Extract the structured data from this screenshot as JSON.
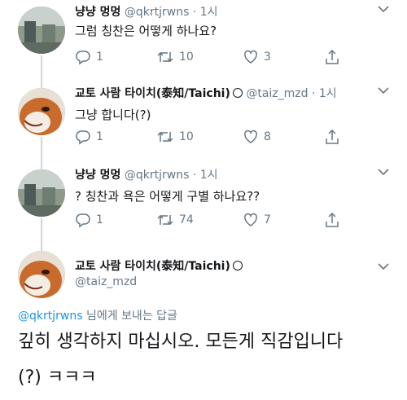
{
  "tweets": [
    {
      "name": "냥냥 멍멍",
      "handle": "@qkrtjrwns",
      "dot": "·",
      "time": "1시",
      "text": "그럼 칭찬은 어떻게 하나요?",
      "replies": "1",
      "retweets": "10",
      "likes": "3"
    },
    {
      "name": "교토 사람 타이치(泰知/Taichi)",
      "handle": "@taiz_mzd",
      "dot": "·",
      "time": "1시",
      "text": "그냥 합니다(?)",
      "replies": "1",
      "retweets": "10",
      "likes": "8"
    },
    {
      "name": "냥냥 멍멍",
      "handle": "@qkrtjrwns",
      "dot": "·",
      "time": "1시",
      "text": "? 칭찬과 욕은 어떻게 구별 하나요??",
      "replies": "1",
      "retweets": "74",
      "likes": "7"
    }
  ],
  "main_tweet": {
    "name": "교토 사람 타이치(泰知/Taichi)",
    "handle": "@taiz_mzd",
    "replying_mention": "@qkrtjrwns",
    "replying_suffix": " 님에게 보내는 답글",
    "text_line1": "깊히 생각하지 마십시오. 모든게 직감입니다",
    "text_line2": "(?) ㅋㅋㅋ"
  },
  "colors": {
    "text": "#14171a",
    "muted": "#657786",
    "link": "#1b95e0",
    "thread_line": "#ccd6dd"
  },
  "icons": [
    "reply-icon",
    "retweet-icon",
    "like-icon",
    "share-icon",
    "chevron-down-icon",
    "verified-icon"
  ]
}
